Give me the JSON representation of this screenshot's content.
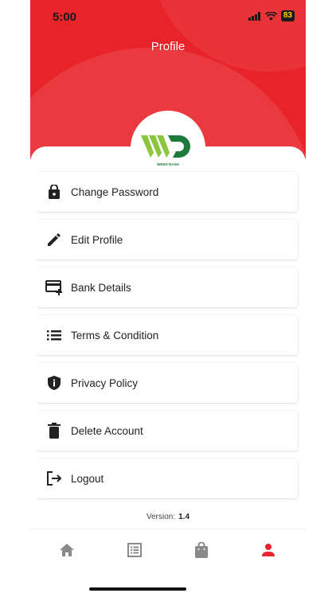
{
  "status_bar": {
    "time": "5:00",
    "battery": "83"
  },
  "header": {
    "title": "Profile"
  },
  "logo": {
    "text": "WEED DASH"
  },
  "menu": [
    {
      "label": "Change Password",
      "icon": "lock-icon"
    },
    {
      "label": "Edit Profile",
      "icon": "pencil-icon"
    },
    {
      "label": "Bank Details",
      "icon": "card-add-icon"
    },
    {
      "label": "Terms & Condition",
      "icon": "list-icon"
    },
    {
      "label": "Privacy Policy",
      "icon": "shield-icon"
    },
    {
      "label": "Delete Account",
      "icon": "trash-icon"
    },
    {
      "label": "Logout",
      "icon": "logout-icon"
    }
  ],
  "version": {
    "label": "Version:",
    "value": "1.4"
  },
  "bottom_nav": [
    {
      "icon": "home-icon",
      "active": false
    },
    {
      "icon": "orders-icon",
      "active": false
    },
    {
      "icon": "shopping-bag-icon",
      "active": false
    },
    {
      "icon": "profile-icon",
      "active": true
    }
  ],
  "colors": {
    "primary": "#e8242a",
    "icon": "#222222",
    "nav_inactive": "#8a8a8a",
    "logo_green_light": "#8cc63f",
    "logo_green_dark": "#1e7a3a"
  }
}
